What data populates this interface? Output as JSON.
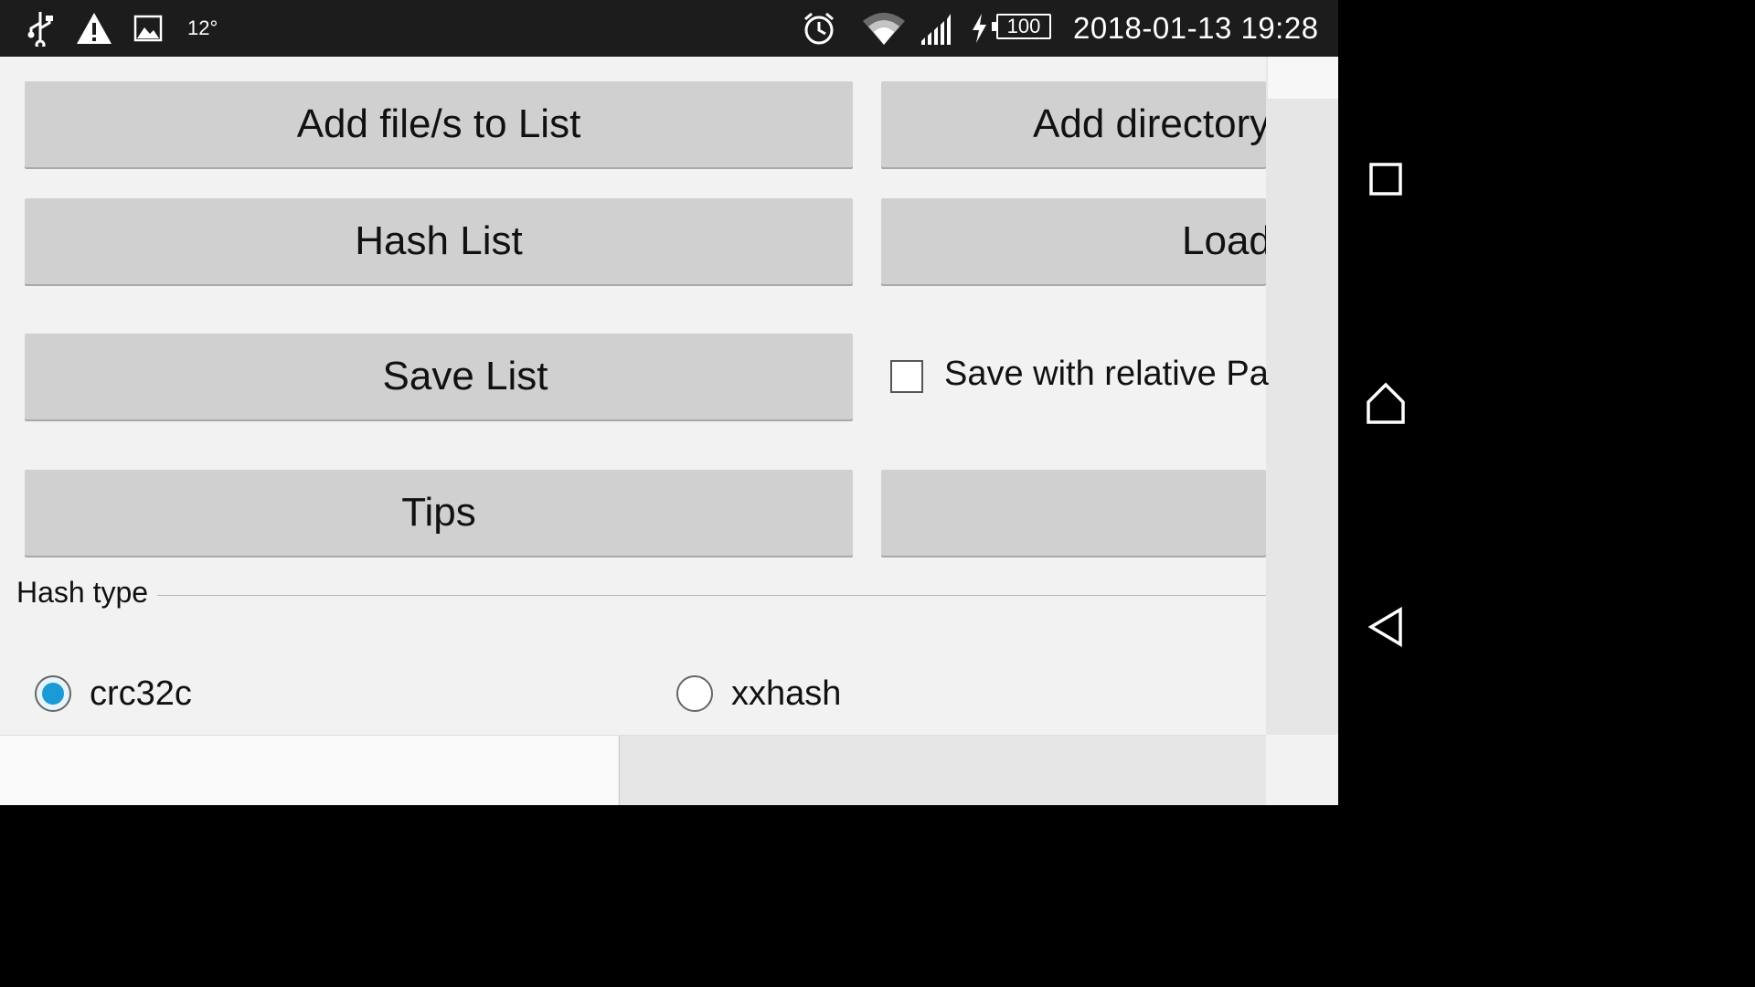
{
  "status_bar": {
    "icons": [
      "usb-icon",
      "warning-icon",
      "image-icon",
      "alarm-icon",
      "wifi-icon",
      "signal-icon",
      "charging-icon"
    ],
    "temperature": "12°",
    "battery": "100",
    "datetime": "2018-01-13 19:28"
  },
  "buttons": {
    "add_files": "Add file/s to List",
    "add_directory": "Add directory",
    "hash_list": "Hash List",
    "load": "Load",
    "save_list": "Save List",
    "tips": "Tips",
    "blank": ""
  },
  "checkbox": {
    "label": "Save with relative Pa",
    "checked": false
  },
  "hash_type": {
    "legend": "Hash type",
    "options": [
      {
        "label": "crc32c",
        "selected": true
      },
      {
        "label": "xxhash",
        "selected": false
      }
    ]
  },
  "colors": {
    "status_bar_bg": "#1c1c1c",
    "app_bg": "#f2f2f2",
    "button_bg": "#d0d0d0",
    "radio_accent": "#1a9ad6"
  },
  "nav_bar": {
    "icons": [
      "recents-icon",
      "home-icon",
      "back-icon"
    ]
  }
}
